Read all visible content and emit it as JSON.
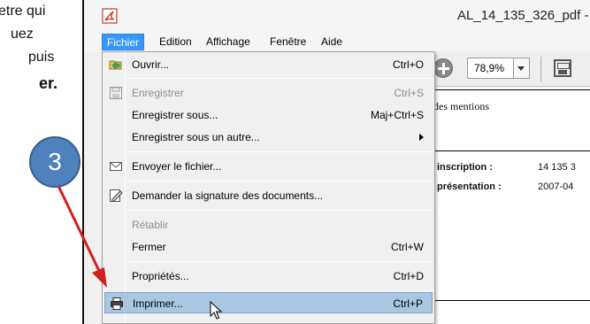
{
  "instructions": {
    "line1": "etre qui",
    "line2": "uez",
    "line3": "puis",
    "line4": "er."
  },
  "step_number": "3",
  "window": {
    "title": "AL_14_135_326_pdf -"
  },
  "menubar": {
    "items": [
      "Fichier",
      "Edition",
      "Affichage",
      "Fenêtre",
      "Aide"
    ],
    "active": "Fichier"
  },
  "toolbar": {
    "zoom_value": "78,9%"
  },
  "document": {
    "mentions_text": "des mentions",
    "row1_label": "inscription :",
    "row1_value": "14 135 3",
    "row2_label": "présentation :",
    "row2_value": "2007-04"
  },
  "file_menu": {
    "items": [
      {
        "label": "Ouvrir...",
        "shortcut": "Ctrl+O",
        "enabled": true,
        "icon": "open-folder-icon"
      },
      {
        "label": "Enregistrer",
        "shortcut": "Ctrl+S",
        "enabled": false,
        "icon": "save-icon"
      },
      {
        "label": "Enregistrer sous...",
        "shortcut": "Maj+Ctrl+S",
        "enabled": true
      },
      {
        "label": "Enregistrer sous un autre...",
        "shortcut": "",
        "enabled": true,
        "submenu": true
      },
      {
        "label": "Envoyer le fichier...",
        "shortcut": "",
        "enabled": true,
        "icon": "envelope-icon"
      },
      {
        "label": "Demander la signature des documents...",
        "shortcut": "",
        "enabled": true,
        "icon": "sign-document-icon"
      },
      {
        "label": "Rétablir",
        "shortcut": "",
        "enabled": false
      },
      {
        "label": "Fermer",
        "shortcut": "Ctrl+W",
        "enabled": true
      },
      {
        "label": "Propriétés...",
        "shortcut": "Ctrl+D",
        "enabled": true
      },
      {
        "label": "Imprimer...",
        "shortcut": "Ctrl+P",
        "enabled": true,
        "highlighted": true,
        "icon": "printer-icon"
      }
    ]
  },
  "colors": {
    "menu_active": "#3399ff",
    "highlight": "#a9c7e0",
    "step_circle": "#4f81bd",
    "arrow": "#d0201e"
  }
}
